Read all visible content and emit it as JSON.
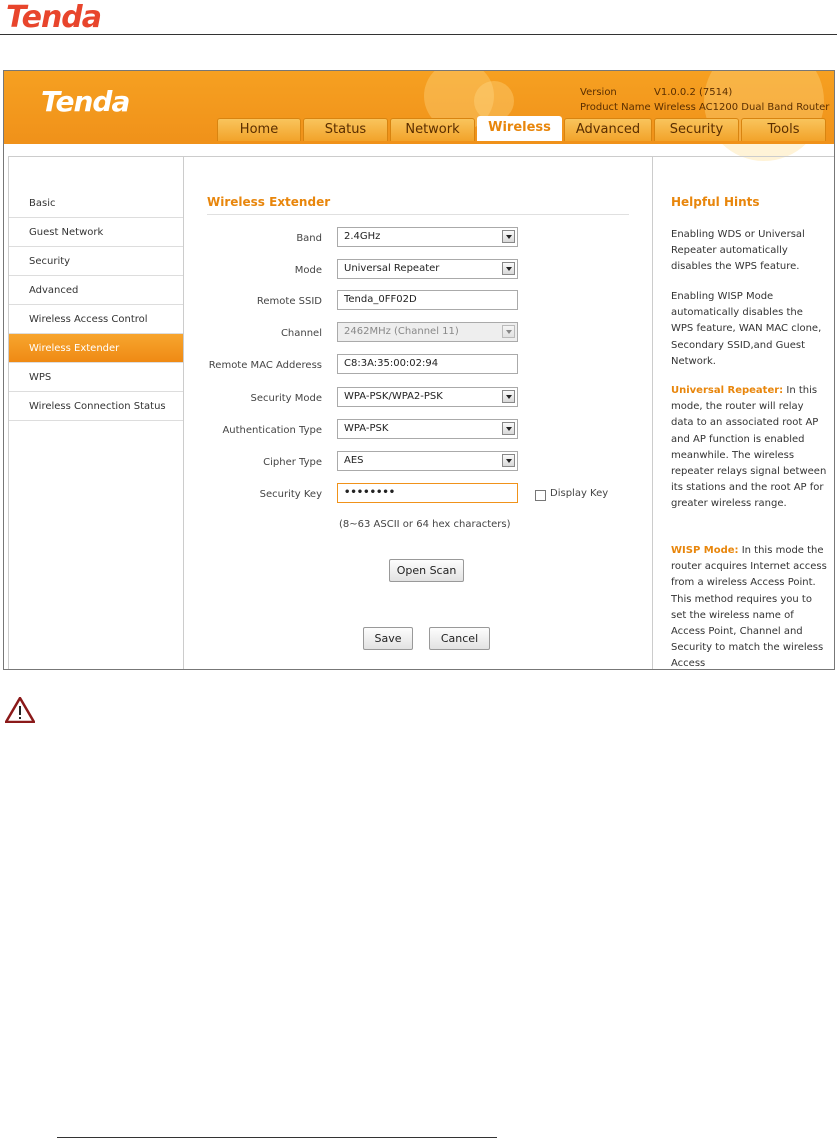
{
  "doc": {
    "logo": "Tenda"
  },
  "ui": {
    "logo": "Tenda",
    "version_label": "Version",
    "version_value": "V1.0.0.2 (7514)",
    "product_label": "Product Name",
    "product_value": "Wireless AC1200 Dual Band Router",
    "tabs": [
      "Home",
      "Status",
      "Network",
      "Wireless",
      "Advanced",
      "Security",
      "Tools"
    ],
    "active_tab": "Wireless"
  },
  "sidebar": {
    "items": [
      "Basic",
      "Guest Network",
      "Security",
      "Advanced",
      "Wireless Access Control",
      "Wireless Extender",
      "WPS",
      "Wireless Connection Status"
    ],
    "active": "Wireless Extender"
  },
  "form": {
    "title": "Wireless Extender",
    "band_label": "Band",
    "band_value": "2.4GHz",
    "mode_label": "Mode",
    "mode_value": "Universal Repeater",
    "ssid_label": "Remote SSID",
    "ssid_value": "Tenda_0FF02D",
    "channel_label": "Channel",
    "channel_value": "2462MHz (Channel 11)",
    "mac_label": "Remote MAC Adderess",
    "mac_value": "C8:3A:35:00:02:94",
    "secmode_label": "Security Mode",
    "secmode_value": "WPA-PSK/WPA2-PSK",
    "auth_label": "Authentication Type",
    "auth_value": "WPA-PSK",
    "cipher_label": "Cipher Type",
    "cipher_value": "AES",
    "key_label": "Security Key",
    "key_value": "••••••••",
    "display_key_label": "Display Key",
    "key_hint": "(8~63 ASCII or 64 hex characters)",
    "open_scan": "Open Scan",
    "save": "Save",
    "cancel": "Cancel"
  },
  "hints": {
    "title": "Helpful Hints",
    "p1": "Enabling WDS or Universal Repeater automatically disables the WPS feature.",
    "p2": "Enabling WISP Mode automatically disables the WPS feature, WAN MAC clone, Secondary SSID,and Guest Network.",
    "p3_kw": "Universal Repeater:",
    "p3": " In this mode, the router will relay data to an associated root AP and AP function is enabled meanwhile. The wireless repeater relays signal between its stations and the root AP for greater wireless range.",
    "p4_kw": "WISP Mode:",
    "p4": " In this mode the router acquires Internet access from a wireless Access Point. This method requires you to set the wireless name of Access Point, Channel and Security to match the wireless Access"
  },
  "colors": {
    "accent": "#f0921a",
    "brand_red": "#e8452c"
  }
}
